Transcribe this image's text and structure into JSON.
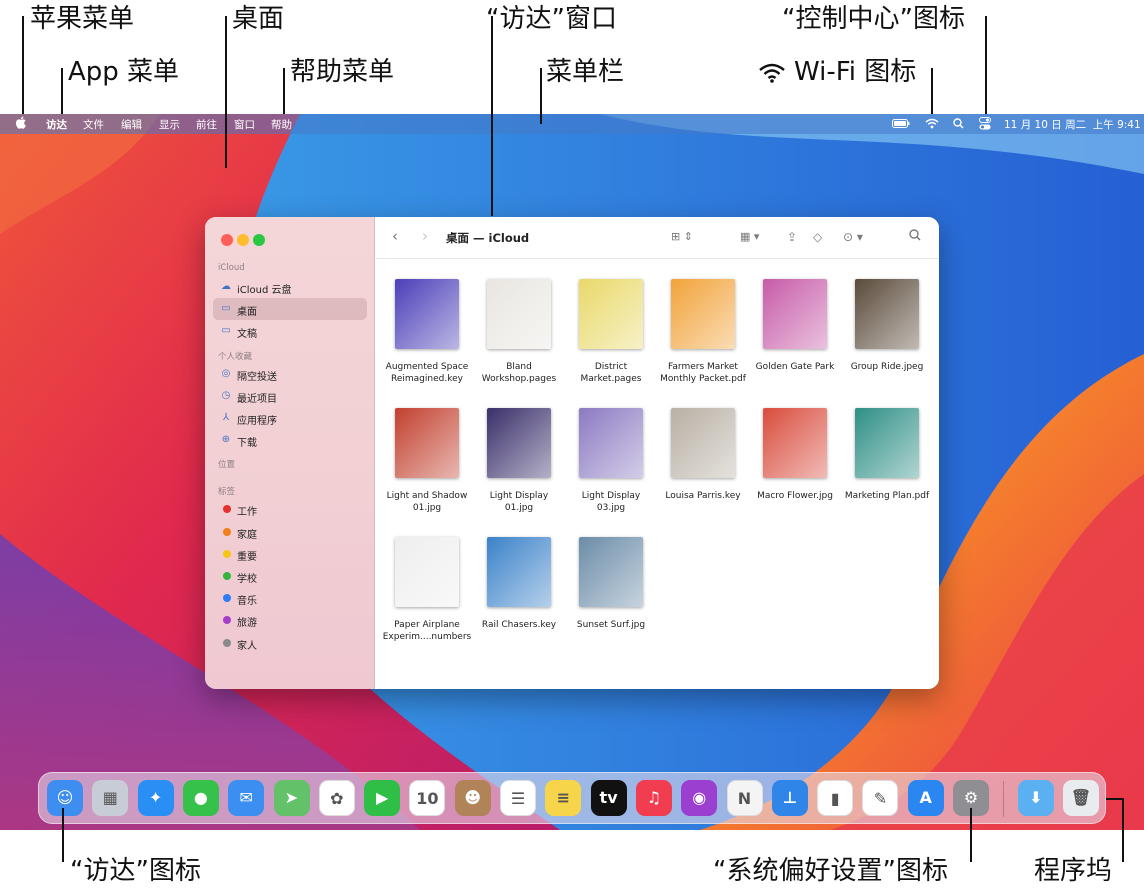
{
  "callouts": {
    "apple_menu": "苹果菜单",
    "app_menu": "App 菜单",
    "desktop": "桌面",
    "help_menu": "帮助菜单",
    "finder_window": "“访达”窗口",
    "menu_bar": "菜单栏",
    "control_center_icon": "“控制中心”图标",
    "wifi_icon": "Wi-Fi 图标",
    "finder_icon": "“访达”图标",
    "system_prefs_icon": "“系统偏好设置”图标",
    "dock": "程序坞"
  },
  "menubar": {
    "apple": "",
    "items": [
      "访达",
      "文件",
      "编辑",
      "显示",
      "前往",
      "窗口",
      "帮助"
    ],
    "datetime": "11 月 10 日 周二  上午 9:41",
    "right_icons": [
      "battery-icon",
      "wifi-icon",
      "search-icon",
      "control-center-icon"
    ]
  },
  "finder": {
    "title": "桌面 — iCloud",
    "sidebar": {
      "sections": [
        {
          "label": "iCloud",
          "items": [
            {
              "label": "iCloud 云盘",
              "icon": "cloud-icon"
            },
            {
              "label": "桌面",
              "icon": "desktop-folder-icon",
              "selected": true
            },
            {
              "label": "文稿",
              "icon": "documents-icon"
            }
          ]
        },
        {
          "label": "个人收藏",
          "items": [
            {
              "label": "隔空投送",
              "icon": "airdrop-icon"
            },
            {
              "label": "最近项目",
              "icon": "clock-icon"
            },
            {
              "label": "应用程序",
              "icon": "applications-icon"
            },
            {
              "label": "下载",
              "icon": "download-icon"
            }
          ]
        },
        {
          "label": "位置",
          "items": []
        },
        {
          "label": "标签",
          "items": [
            {
              "label": "工作",
              "color": "#e5302b"
            },
            {
              "label": "家庭",
              "color": "#f07e1a"
            },
            {
              "label": "重要",
              "color": "#f5c518"
            },
            {
              "label": "学校",
              "color": "#36b33a"
            },
            {
              "label": "音乐",
              "color": "#2e7cf6"
            },
            {
              "label": "旅游",
              "color": "#a53fc9"
            },
            {
              "label": "家人",
              "color": "#8a8a8a"
            }
          ]
        }
      ]
    },
    "files": [
      {
        "name": "Augmented Space\nReimagined.key",
        "color": "#4b3fb8"
      },
      {
        "name": "Bland\nWorkshop.pages",
        "color": "#e9e6e1"
      },
      {
        "name": "District\nMarket.pages",
        "color": "#e9d96a"
      },
      {
        "name": "Farmers Market\nMonthly Packet.pdf",
        "color": "#f2a33a"
      },
      {
        "name": "Golden Gate Park",
        "color": "#c75ba8"
      },
      {
        "name": "Group Ride.jpeg",
        "color": "#5a4a3a"
      },
      {
        "name": "Light and Shadow\n01.jpg",
        "color": "#c2402f"
      },
      {
        "name": "Light Display\n01.jpg",
        "color": "#3a2f6a"
      },
      {
        "name": "Light Display\n03.jpg",
        "color": "#8c7ac2"
      },
      {
        "name": "Louisa Parris.key",
        "color": "#b8b0a4"
      },
      {
        "name": "Macro Flower.jpg",
        "color": "#d94c3d"
      },
      {
        "name": "Marketing Plan.pdf",
        "color": "#2e8f86"
      },
      {
        "name": "Paper Airplane\nExperim....numbers",
        "color": "#eeeeee"
      },
      {
        "name": "Rail Chasers.key",
        "color": "#3b82c9"
      },
      {
        "name": "Sunset Surf.jpg",
        "color": "#6b8ca8"
      }
    ]
  },
  "dock": {
    "apps": [
      {
        "name": "finder-icon",
        "color": "#3d8ef0",
        "glyph": "☺"
      },
      {
        "name": "launchpad-icon",
        "color": "#c8ccd6",
        "glyph": "▦"
      },
      {
        "name": "safari-icon",
        "color": "#2a8ff5",
        "glyph": "✦"
      },
      {
        "name": "messages-icon",
        "color": "#36c24a",
        "glyph": "●"
      },
      {
        "name": "mail-icon",
        "color": "#3b8ff0",
        "glyph": "✉"
      },
      {
        "name": "maps-icon",
        "color": "#63c269",
        "glyph": "➤"
      },
      {
        "name": "photos-icon",
        "color": "#ffffff",
        "glyph": "✿"
      },
      {
        "name": "facetime-icon",
        "color": "#2fbf47",
        "glyph": "▶"
      },
      {
        "name": "calendar-icon",
        "color": "#ffffff",
        "glyph": "10"
      },
      {
        "name": "contacts-icon",
        "color": "#b08458",
        "glyph": "☻"
      },
      {
        "name": "reminders-icon",
        "color": "#ffffff",
        "glyph": "☰"
      },
      {
        "name": "notes-icon",
        "color": "#f7d54a",
        "glyph": "≡"
      },
      {
        "name": "tv-icon",
        "color": "#111111",
        "glyph": "tv"
      },
      {
        "name": "music-icon",
        "color": "#f23c50",
        "glyph": "♫"
      },
      {
        "name": "podcasts-icon",
        "color": "#9b3fd1",
        "glyph": "◉"
      },
      {
        "name": "news-icon",
        "color": "#f4f4f4",
        "glyph": "N"
      },
      {
        "name": "keynote-icon",
        "color": "#2f86e8",
        "glyph": "⊥"
      },
      {
        "name": "numbers-icon",
        "color": "#ffffff",
        "glyph": "▮"
      },
      {
        "name": "pages-icon",
        "color": "#ffffff",
        "glyph": "✎"
      },
      {
        "name": "app-store-icon",
        "color": "#2a86f0",
        "glyph": "A"
      },
      {
        "name": "system-preferences-icon",
        "color": "#8e8e93",
        "glyph": "⚙"
      }
    ],
    "right": [
      {
        "name": "downloads-folder-icon",
        "color": "#5ab0f0",
        "glyph": "⬇"
      },
      {
        "name": "trash-icon",
        "color": "#e9ecef",
        "glyph": "🗑"
      }
    ]
  }
}
